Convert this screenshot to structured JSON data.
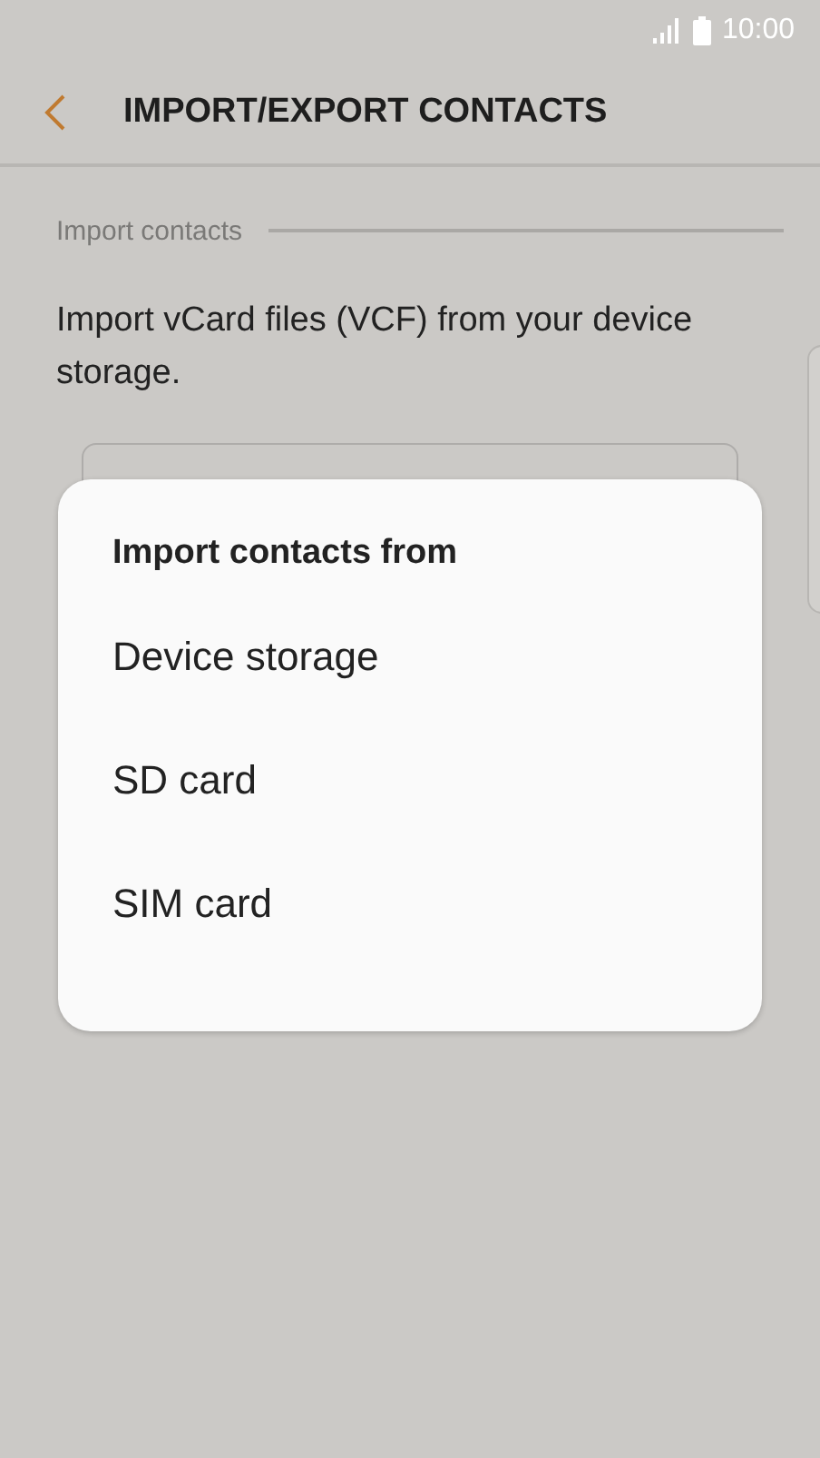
{
  "status_bar": {
    "time": "10:00"
  },
  "header": {
    "title": "IMPORT/EXPORT CONTACTS"
  },
  "section": {
    "title": "Import contacts",
    "description": "Import vCard files (VCF) from your device storage."
  },
  "dialog": {
    "title": "Import contacts from",
    "options": [
      "Device storage",
      "SD card",
      "SIM card"
    ]
  }
}
